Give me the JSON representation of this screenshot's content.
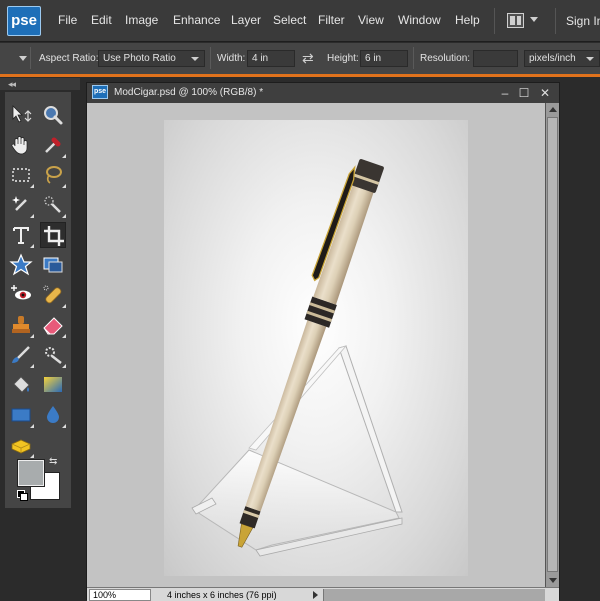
{
  "app": {
    "logo_text": "pse",
    "menu": [
      "File",
      "Edit",
      "Image",
      "Enhance",
      "Layer",
      "Select",
      "Filter",
      "View",
      "Window",
      "Help"
    ],
    "sign_in": "Sign In"
  },
  "options": {
    "aspect_label": "Aspect Ratio:",
    "aspect_value": "Use Photo Ratio",
    "width_label": "Width:",
    "width_value": "4 in",
    "height_label": "Height:",
    "height_value": "6 in",
    "resolution_label": "Resolution:",
    "resolution_value": "",
    "resolution_unit": "pixels/inch"
  },
  "toolbox": {
    "tools": [
      {
        "name": "move-tool-icon"
      },
      {
        "name": "zoom-tool-icon"
      },
      {
        "name": "hand-tool-icon"
      },
      {
        "name": "eyedropper-tool-icon"
      },
      {
        "name": "rectangular-marquee-icon"
      },
      {
        "name": "lasso-tool-icon"
      },
      {
        "name": "magic-wand-icon"
      },
      {
        "name": "quick-selection-icon"
      },
      {
        "name": "type-tool-icon"
      },
      {
        "name": "crop-tool-icon"
      },
      {
        "name": "cookie-cutter-icon"
      },
      {
        "name": "straighten-tool-icon"
      },
      {
        "name": "red-eye-tool-icon"
      },
      {
        "name": "spot-healing-icon"
      },
      {
        "name": "clone-stamp-icon"
      },
      {
        "name": "eraser-tool-icon"
      },
      {
        "name": "brush-tool-icon"
      },
      {
        "name": "smart-brush-icon"
      },
      {
        "name": "paint-bucket-icon"
      },
      {
        "name": "gradient-tool-icon"
      },
      {
        "name": "shape-tool-icon"
      },
      {
        "name": "blur-tool-icon"
      },
      {
        "name": "sponge-tool-icon"
      }
    ],
    "foreground_color": "#a8acad",
    "background_color": "#ffffff"
  },
  "document": {
    "title": "ModCigar.psd @ 100% (RGB/8) *",
    "zoom": "100%",
    "status": "4 inches x 6 inches (76 ppi)"
  },
  "colors": {
    "accent": "#e0721c",
    "logo_blue": "#1e6fb8"
  }
}
